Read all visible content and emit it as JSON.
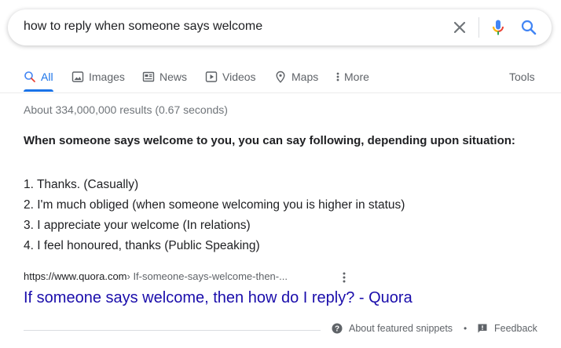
{
  "search": {
    "query": "how to reply when someone says welcome"
  },
  "tabs": [
    {
      "label": "All",
      "active": true,
      "icon": "search-icon"
    },
    {
      "label": "Images",
      "icon": "image-icon"
    },
    {
      "label": "News",
      "icon": "news-icon"
    },
    {
      "label": "Videos",
      "icon": "video-icon"
    },
    {
      "label": "Maps",
      "icon": "map-pin-icon"
    },
    {
      "label": "More",
      "icon": "more-vert-icon"
    }
  ],
  "tools_label": "Tools",
  "result_stats": "About 334,000,000 results (0.67 seconds)",
  "snippet": {
    "heading": "When someone says welcome to you, you can say following, depending upon situation:",
    "items": [
      "1. Thanks. (Casually)",
      "2. I'm much obliged (when someone welcoming you is higher in status)",
      "3. I appreciate your welcome (In relations)",
      "4. I feel honoured, thanks (Public Speaking)"
    ],
    "source_url": "https://www.quora.com",
    "source_path": " › If-someone-says-welcome-then-...",
    "title": "If someone says welcome, then how do I reply? - Quora"
  },
  "footer": {
    "about": "About featured snippets",
    "separator": "•",
    "feedback": "Feedback"
  },
  "colors": {
    "accent": "#1a73e8",
    "link": "#1a0dab",
    "muted": "#70757a"
  }
}
